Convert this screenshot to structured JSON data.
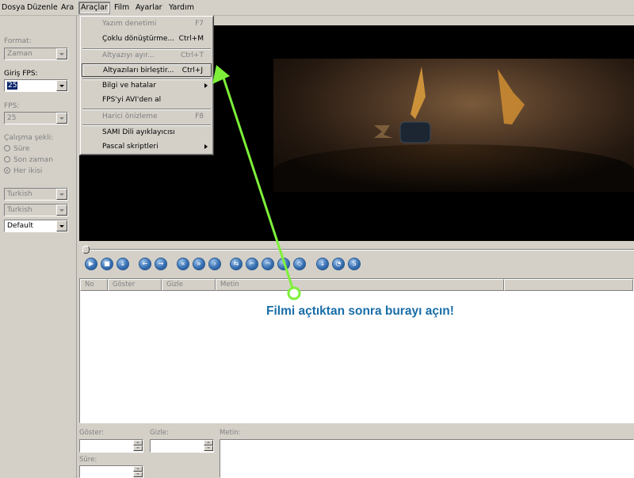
{
  "menubar": {
    "items": [
      "Dosya",
      "Düzenle",
      "Ara",
      "Araçlar",
      "Film",
      "Ayarlar",
      "Yardım"
    ]
  },
  "left_panel": {
    "format_label": "Format:",
    "format_value": "Zaman",
    "input_fps_label": "Giriş FPS:",
    "input_fps_value": "25",
    "fps_label": "FPS:",
    "fps_value": "25",
    "mode_label": "Çalışma şekli:",
    "mode_options": [
      "Süre",
      "Son zaman",
      "Her ikisi"
    ],
    "mode_selected": "Her ikisi",
    "language1": "Turkish",
    "language2": "Turkish",
    "style": "Default"
  },
  "tools_menu": {
    "items": [
      {
        "label": "Yazım denetimi",
        "shortcut": "F7",
        "disabled": true
      },
      {
        "label": "Çoklu dönüştürme...",
        "shortcut": "Ctrl+M",
        "disabled": false
      },
      {
        "label": "Altyazıyı ayır...",
        "shortcut": "Ctrl+T",
        "disabled": true
      },
      {
        "label": "Altyazıları birleştir...",
        "shortcut": "Ctrl+J",
        "disabled": false,
        "highlighted": true
      },
      {
        "label": "Bilgi ve hatalar",
        "shortcut": "",
        "submenu": true
      },
      {
        "label": "FPS'yi AVI'den al",
        "shortcut": ""
      },
      {
        "label": "Harici önizleme",
        "shortcut": "F8",
        "disabled": true
      },
      {
        "label": "SAMI Dili ayıklayıcısı",
        "shortcut": ""
      },
      {
        "label": "Pascal skriptleri",
        "shortcut": "",
        "submenu": true
      }
    ]
  },
  "subtitle_list": {
    "columns": [
      "No",
      "Göster",
      "Gizle",
      "Metin"
    ]
  },
  "edit_panel": {
    "show_label": "Göster:",
    "hide_label": "Gizle:",
    "duration_label": "Süre:",
    "text_label": "Metin:"
  },
  "annotation": {
    "text": "Filmi açtıktan sonra burayı açın!",
    "color": "#1a6ea8",
    "arrow_color": "#7ef03a"
  },
  "transport_icons": [
    "play-icon",
    "stop-icon",
    "down-icon",
    "back-icon",
    "forward-icon",
    "rewind-icon",
    "fast-forward-icon",
    "next-frame-icon",
    "loop-icon",
    "set-start-icon",
    "set-end-icon",
    "mark-icon",
    "code-icon",
    "save-icon",
    "timer-icon",
    "sync-icon"
  ]
}
